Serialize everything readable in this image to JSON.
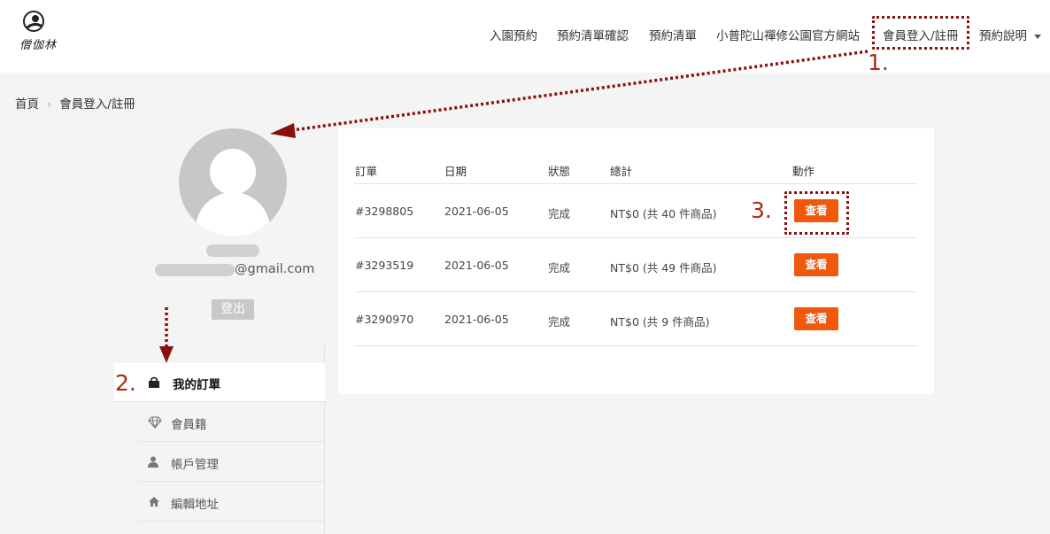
{
  "header": {
    "logo_text": "僧伽林",
    "nav": [
      {
        "label": "入園預約"
      },
      {
        "label": "預約清單確認"
      },
      {
        "label": "預約清單"
      },
      {
        "label": "小普陀山禪修公園官方網站"
      },
      {
        "label": "會員登入/註冊"
      },
      {
        "label": "預約說明"
      }
    ]
  },
  "annotations": {
    "step1": "1.",
    "step2": "2.",
    "step3": "3."
  },
  "breadcrumb": {
    "home": "首頁",
    "current": "會員登入/註冊"
  },
  "profile": {
    "email_suffix": "@gmail.com",
    "logout_label": "登出"
  },
  "sidemenu": {
    "items": [
      {
        "label": "我的訂單",
        "icon": "shopping-bag-icon"
      },
      {
        "label": "會員籍",
        "icon": "diamond-icon"
      },
      {
        "label": "帳戶管理",
        "icon": "user-icon"
      },
      {
        "label": "編輯地址",
        "icon": "home-icon"
      }
    ]
  },
  "orders": {
    "columns": [
      "訂單",
      "日期",
      "狀態",
      "總計",
      "動作"
    ],
    "rows": [
      {
        "id": "#3298805",
        "date": "2021-06-05",
        "status": "完成",
        "total": "NT$0 (共 40 件商品)",
        "action": "查看"
      },
      {
        "id": "#3293519",
        "date": "2021-06-05",
        "status": "完成",
        "total": "NT$0 (共 49 件商品)",
        "action": "查看"
      },
      {
        "id": "#3290970",
        "date": "2021-06-05",
        "status": "完成",
        "total": "NT$0 (共 9 件商品)",
        "action": "查看"
      }
    ]
  },
  "colors": {
    "accent": "#f0580c",
    "annotation": "#8b0f0f",
    "annotation_number": "#b02a10"
  }
}
